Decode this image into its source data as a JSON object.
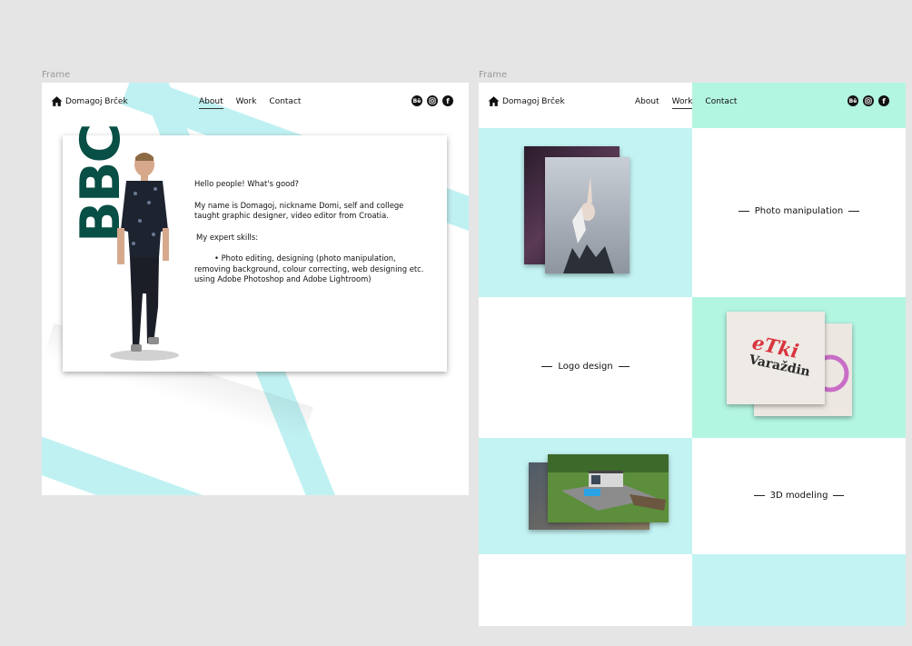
{
  "frames": [
    {
      "label": "Frame",
      "brand": "Domagoj Brček",
      "nav": [
        "About",
        "Work",
        "Contact"
      ],
      "active_nav": "About",
      "socials": [
        "Bē",
        "instagram",
        "f"
      ],
      "logo_text": "BBC",
      "bio": {
        "greeting": "Hello people! What's good?",
        "intro": "My name is Domagoj, nickname Domi, self and college taught graphic designer, video editor from Croatia.",
        "skills_heading": "My expert skills:",
        "skills_item": "• Photo editing, designing  (photo manipulation, removing background, colour correcting,  web designing etc. using Adobe Photoshop and Adobe Lightroom)"
      }
    },
    {
      "label": "Frame",
      "brand": "Domagoj Brček",
      "nav": [
        "About",
        "Work",
        "Contact"
      ],
      "active_nav": "Work",
      "socials": [
        "Bē",
        "instagram",
        "f"
      ],
      "work": [
        "Photo manipulation",
        "Logo design",
        "3D modeling"
      ],
      "logo_thumb_text": [
        "eTki",
        "Varaždin"
      ]
    }
  ],
  "colors": {
    "cyan": "#c3f3f3",
    "mint": "#b2f5e1",
    "bbc_green": "#084f45",
    "background": "#e5e5e5"
  }
}
